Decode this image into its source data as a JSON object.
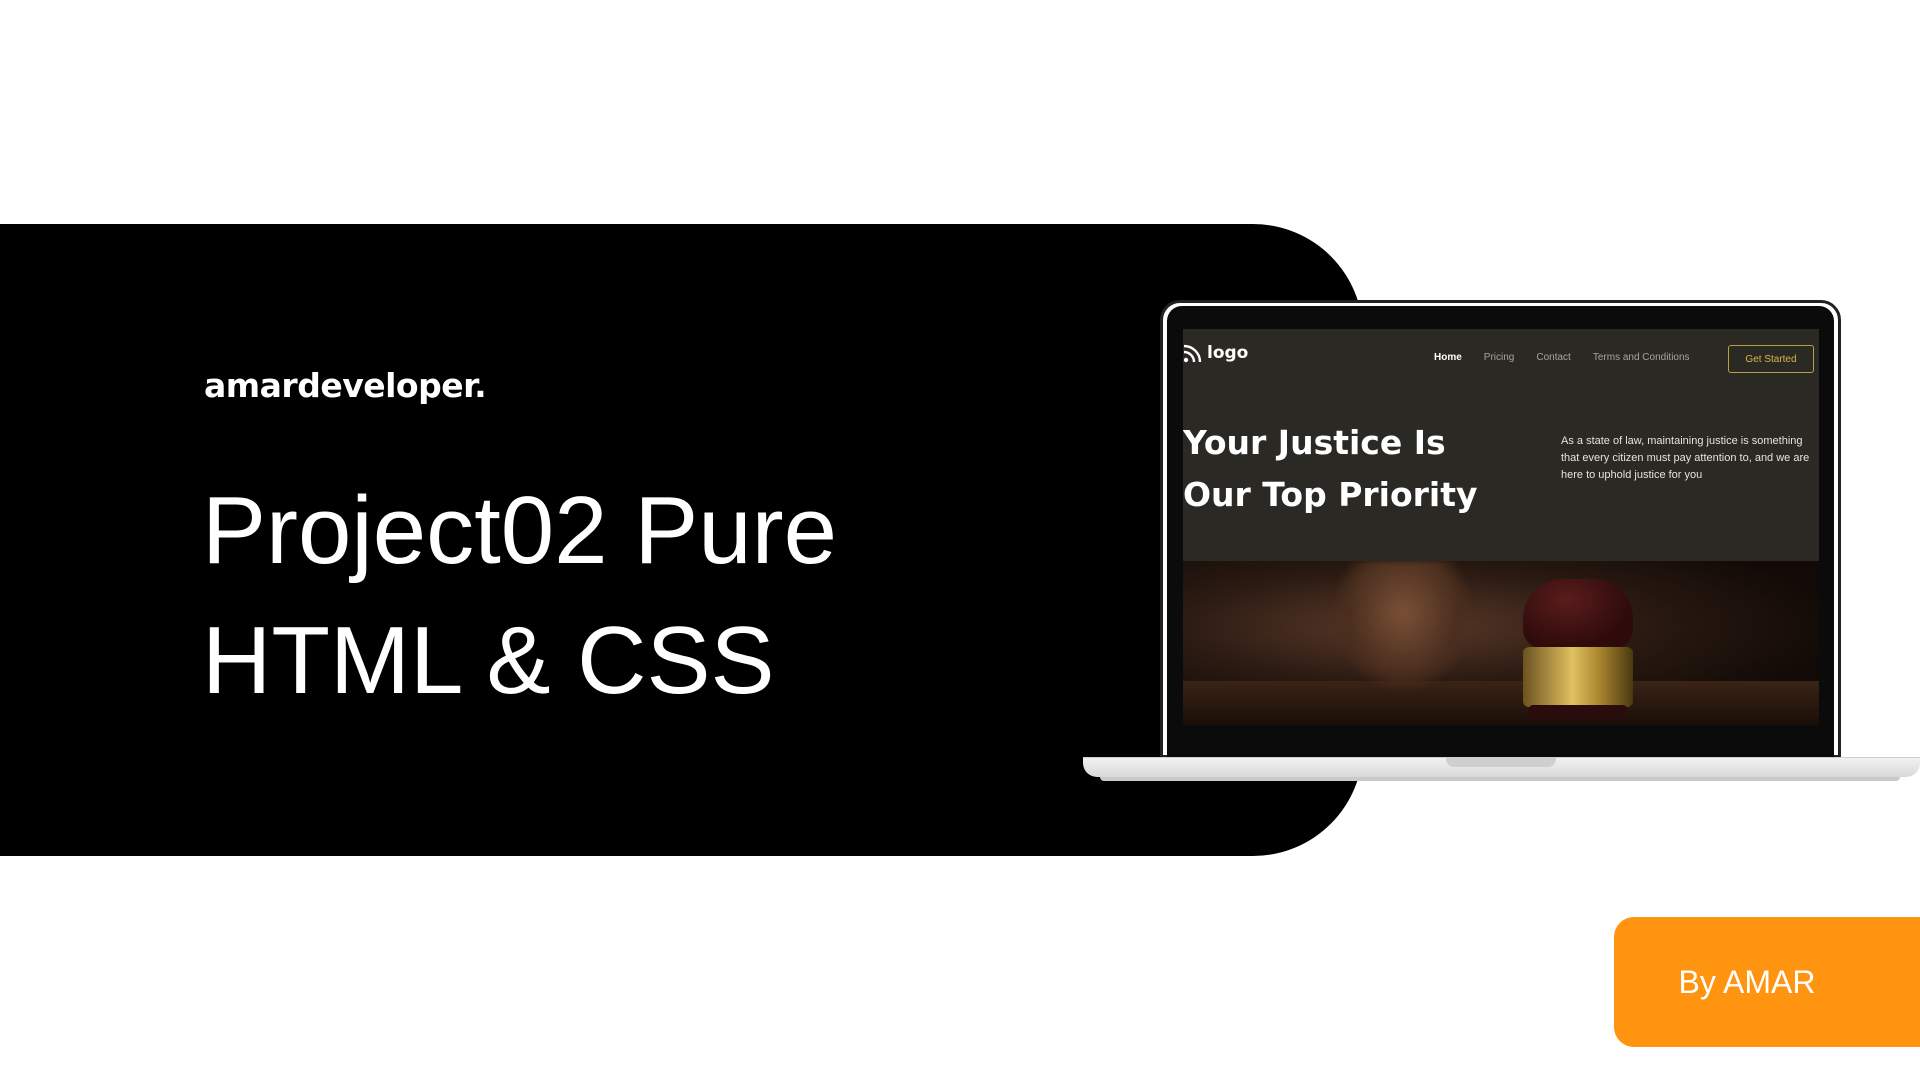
{
  "brand": "amardeveloper.",
  "title_line1": "Project02 Pure",
  "title_line2": "HTML & CSS",
  "laptop_screen": {
    "logo_text": "logo",
    "logo_icon": "rss-icon",
    "nav": [
      {
        "label": "Home",
        "active": true
      },
      {
        "label": "Pricing",
        "active": false
      },
      {
        "label": "Contact",
        "active": false
      },
      {
        "label": "Terms and Conditions",
        "active": false
      }
    ],
    "cta_label": "Get Started",
    "heading_line1": "Your Justice Is",
    "heading_line2": "Our Top Priority",
    "description": "As a state of law, maintaining justice is something that every citizen must pay attention to, and we are here to uphold justice for you",
    "image": "gavel-photo"
  },
  "byline": "By AMAR",
  "colors": {
    "background": "#ffffff",
    "band": "#000000",
    "accent": "#ff9410",
    "screen_bg": "#2b2924",
    "cta_border": "#b8a044"
  }
}
